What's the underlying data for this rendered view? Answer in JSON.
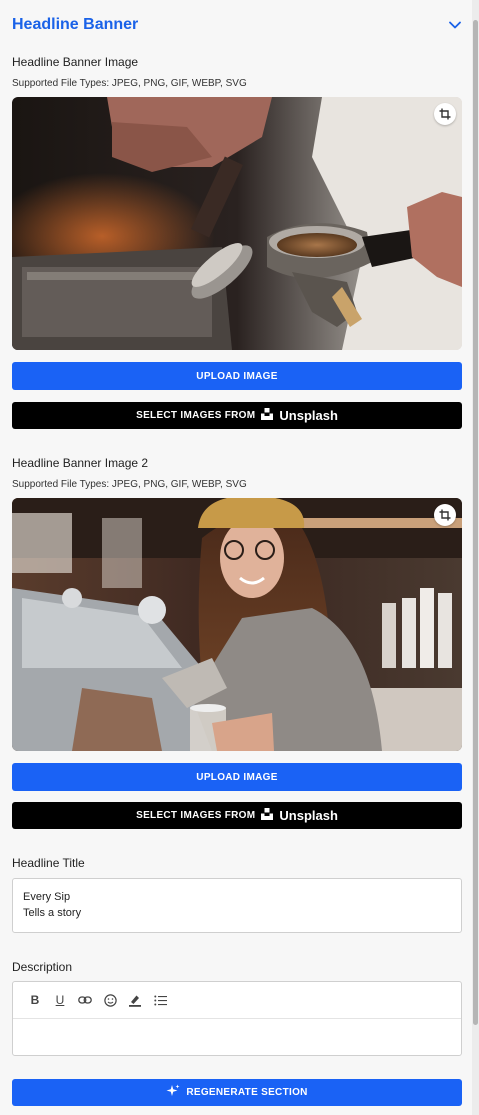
{
  "section": {
    "title": "Headline Banner"
  },
  "image1": {
    "label": "Headline Banner Image",
    "file_types": "Supported File Types: JPEG, PNG, GIF, WEBP, SVG",
    "upload_label": "UPLOAD IMAGE",
    "unsplash_label": "SELECT IMAGES FROM",
    "unsplash_brand": "Unsplash"
  },
  "image2": {
    "label": "Headline Banner Image 2",
    "file_types": "Supported File Types: JPEG, PNG, GIF, WEBP, SVG",
    "upload_label": "UPLOAD IMAGE",
    "unsplash_label": "SELECT IMAGES FROM",
    "unsplash_brand": "Unsplash"
  },
  "headline_title": {
    "label": "Headline Title",
    "line1": "Every Sip",
    "line2": "Tells a story"
  },
  "description": {
    "label": "Description",
    "toolbar": [
      "bold-icon",
      "underline-icon",
      "link-icon",
      "emoji-icon",
      "highlight-icon",
      "list-icon"
    ],
    "value": ""
  },
  "regenerate": {
    "label": "REGENERATE SECTION"
  },
  "colors": {
    "accent": "#1a62f5",
    "title": "#1a62e8",
    "unsplash_bg": "#000000"
  }
}
